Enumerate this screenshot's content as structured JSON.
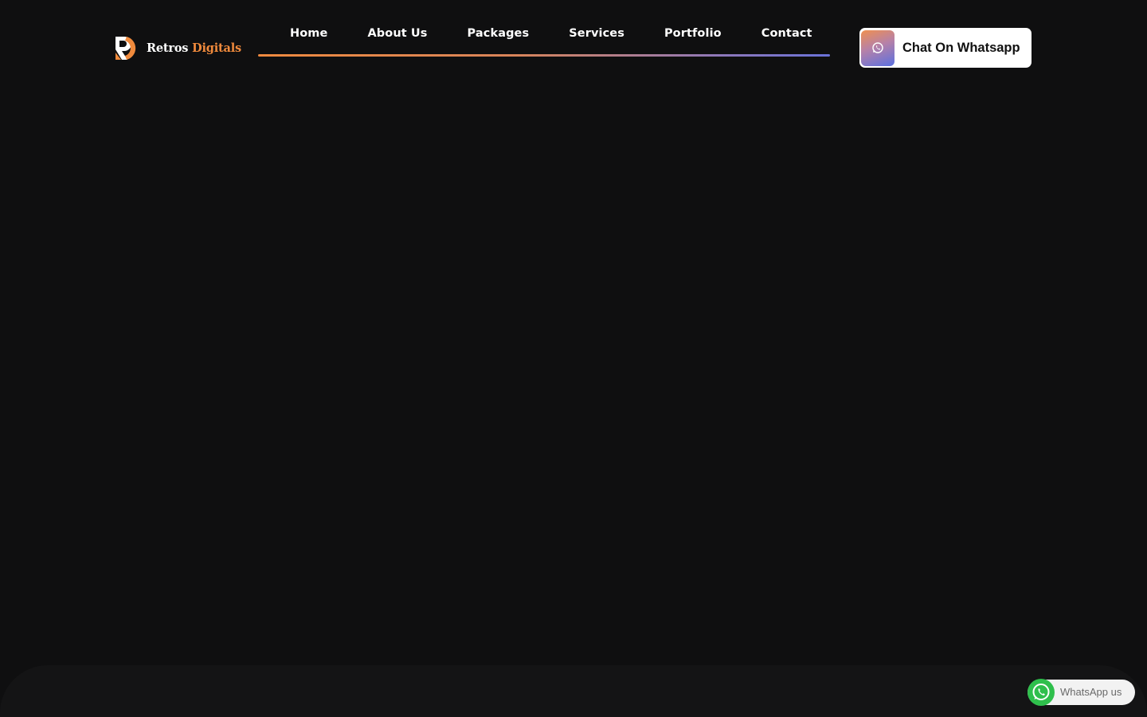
{
  "header": {
    "logo": {
      "name_primary": "Retros",
      "name_accent": "Digitals",
      "accent_color": "#f08a3c"
    },
    "nav": {
      "items": [
        {
          "label": "Home"
        },
        {
          "label": "About Us"
        },
        {
          "label": "Packages"
        },
        {
          "label": "Services"
        },
        {
          "label": "Portfolio"
        },
        {
          "label": "Contact"
        }
      ],
      "underline_gradient": [
        "#ef8a3f",
        "#6a72d8"
      ]
    },
    "cta": {
      "label": "Chat On Whatsapp",
      "icon": "whatsapp-icon"
    }
  },
  "floating_whatsapp": {
    "label": "WhatsApp us",
    "icon": "whatsapp-icon",
    "icon_color": "#2fbf4c"
  },
  "colors": {
    "background": "#0f0f10",
    "text": "#ffffff"
  }
}
